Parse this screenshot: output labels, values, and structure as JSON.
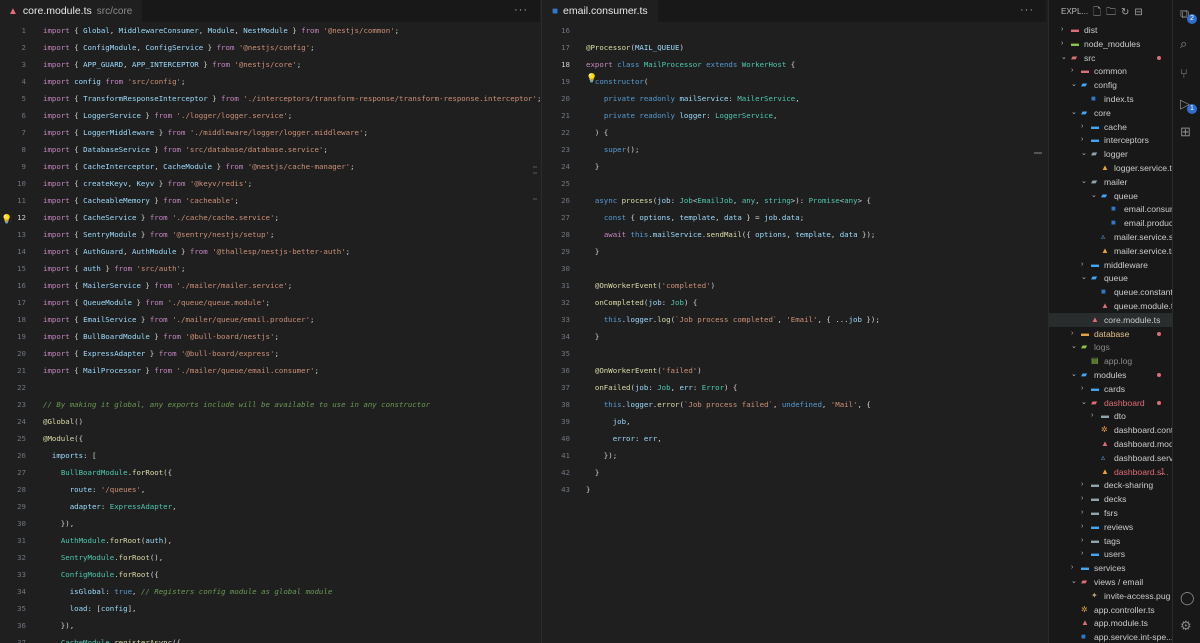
{
  "pane1": {
    "tab": {
      "name": "core.module.ts",
      "path": "src/core"
    },
    "lines": [
      {
        "n": "1",
        "h": "<span class=\"k\">import</span> { <span class=\"v\">Global</span>, <span class=\"v\">MiddlewareConsumer</span>, <span class=\"v\">Module</span>, <span class=\"v\">NestModule</span> } <span class=\"k\">from</span> <span class=\"s\">'@nestjs/common'</span>;"
      },
      {
        "n": "2",
        "h": "<span class=\"k\">import</span> { <span class=\"v\">ConfigModule</span>, <span class=\"v\">ConfigService</span> } <span class=\"k\">from</span> <span class=\"s\">'@nestjs/config'</span>;"
      },
      {
        "n": "3",
        "h": "<span class=\"k\">import</span> { <span class=\"v\">APP_GUARD</span>, <span class=\"v\">APP_INTERCEPTOR</span> } <span class=\"k\">from</span> <span class=\"s\">'@nestjs/core'</span>;"
      },
      {
        "n": "4",
        "h": "<span class=\"k\">import</span> <span class=\"v\">config</span> <span class=\"k\">from</span> <span class=\"s\">'src/config'</span>;"
      },
      {
        "n": "5",
        "h": "<span class=\"k\">import</span> { <span class=\"v\">TransformResponseInterceptor</span> } <span class=\"k\">from</span> <span class=\"s\">'./interceptors/transform-response/transform-response.interceptor'</span>;"
      },
      {
        "n": "6",
        "h": "<span class=\"k\">import</span> { <span class=\"v\">LoggerService</span> } <span class=\"k\">from</span> <span class=\"s\">'./logger/logger.service'</span>;"
      },
      {
        "n": "7",
        "h": "<span class=\"k\">import</span> { <span class=\"v\">LoggerMiddleware</span> } <span class=\"k\">from</span> <span class=\"s\">'./middleware/logger/logger.middleware'</span>;"
      },
      {
        "n": "8",
        "h": "<span class=\"k\">import</span> { <span class=\"v\">DatabaseService</span> } <span class=\"k\">from</span> <span class=\"s\">'src/database/database.service'</span>;"
      },
      {
        "n": "9",
        "h": "<span class=\"k\">import</span> { <span class=\"v\">CacheInterceptor</span>, <span class=\"v\">CacheModule</span> } <span class=\"k\">from</span> <span class=\"s\">'@nestjs/cache-manager'</span>;"
      },
      {
        "n": "10",
        "h": "<span class=\"k\">import</span> { <span class=\"v\">createKeyv</span>, <span class=\"v\">Keyv</span> } <span class=\"k\">from</span> <span class=\"s\">'@keyv/redis'</span>;"
      },
      {
        "n": "11",
        "h": "<span class=\"k\">import</span> { <span class=\"v\">CacheableMemory</span> } <span class=\"k\">from</span> <span class=\"s\">'cacheable'</span>;"
      },
      {
        "n": "12",
        "h": "<span class=\"k\">import</span> { <span class=\"v\">CacheService</span> } <span class=\"k\">from</span> <span class=\"s\">'./cache/cache.service'</span>;"
      },
      {
        "n": "13",
        "h": "<span class=\"k\">import</span> { <span class=\"v\">SentryModule</span> } <span class=\"k\">from</span> <span class=\"s\">'@sentry/nestjs/setup'</span>;"
      },
      {
        "n": "14",
        "h": "<span class=\"k\">import</span> { <span class=\"v\">AuthGuard</span>, <span class=\"v\">AuthModule</span> } <span class=\"k\">from</span> <span class=\"s\">'@thallesp/nestjs-better-auth'</span>;"
      },
      {
        "n": "15",
        "h": "<span class=\"k\">import</span> { <span class=\"v\">auth</span> } <span class=\"k\">from</span> <span class=\"s\">'src/auth'</span>;"
      },
      {
        "n": "16",
        "h": "<span class=\"k\">import</span> { <span class=\"v\">MailerService</span> } <span class=\"k\">from</span> <span class=\"s\">'./mailer/mailer.service'</span>;"
      },
      {
        "n": "17",
        "h": "<span class=\"k\">import</span> { <span class=\"v\">QueueModule</span> } <span class=\"k\">from</span> <span class=\"s\">'./queue/queue.module'</span>;"
      },
      {
        "n": "18",
        "h": "<span class=\"k\">import</span> { <span class=\"v\">EmailService</span> } <span class=\"k\">from</span> <span class=\"s\">'./mailer/queue/email.producer'</span>;"
      },
      {
        "n": "19",
        "h": "<span class=\"k\">import</span> { <span class=\"v\">BullBoardModule</span> } <span class=\"k\">from</span> <span class=\"s\">'@bull-board/nestjs'</span>;"
      },
      {
        "n": "20",
        "h": "<span class=\"k\">import</span> { <span class=\"v\">ExpressAdapter</span> } <span class=\"k\">from</span> <span class=\"s\">'@bull-board/express'</span>;"
      },
      {
        "n": "21",
        "h": "<span class=\"k\">import</span> { <span class=\"v\">MailProcessor</span> } <span class=\"k\">from</span> <span class=\"s\">'./mailer/queue/email.consumer'</span>;"
      },
      {
        "n": "22",
        "h": ""
      },
      {
        "n": "23",
        "h": "<span class=\"c\">// By making it global, any exports include will be available to use in any constructor</span>"
      },
      {
        "n": "24",
        "h": "<span class=\"d\">@Global</span>()"
      },
      {
        "n": "25",
        "h": "<span class=\"d\">@Module</span>({"
      },
      {
        "n": "26",
        "h": "  <span class=\"v\">imports</span>: ["
      },
      {
        "n": "27",
        "h": "    <span class=\"t\">BullBoardModule</span>.<span class=\"f\">forRoot</span>({"
      },
      {
        "n": "28",
        "h": "      <span class=\"v\">route</span>: <span class=\"s\">'/queues'</span>,"
      },
      {
        "n": "29",
        "h": "      <span class=\"v\">adapter</span>: <span class=\"t\">ExpressAdapter</span>,"
      },
      {
        "n": "30",
        "h": "    }),"
      },
      {
        "n": "31",
        "h": "    <span class=\"t\">AuthModule</span>.<span class=\"f\">forRoot</span>(<span class=\"v\">auth</span>),"
      },
      {
        "n": "32",
        "h": "    <span class=\"t\">SentryModule</span>.<span class=\"f\">forRoot</span>(),"
      },
      {
        "n": "33",
        "h": "    <span class=\"t\">ConfigModule</span>.<span class=\"f\">forRoot</span>({"
      },
      {
        "n": "34",
        "h": "      <span class=\"v\">isGlobal</span>: <span class=\"kb\">true</span>, <span class=\"c\">// Registers config module as global module</span>"
      },
      {
        "n": "35",
        "h": "      <span class=\"v\">load</span>: [<span class=\"v\">config</span>],"
      },
      {
        "n": "36",
        "h": "    }),"
      },
      {
        "n": "37",
        "h": "    <span class=\"t\">CacheModule</span>.<span class=\"f\">registerAsync</span>({"
      }
    ]
  },
  "pane2": {
    "tab": {
      "name": "email.consumer.ts"
    },
    "lines": [
      {
        "n": "16",
        "h": ""
      },
      {
        "n": "17",
        "h": "<span class=\"d\">@Processor</span>(<span class=\"v\">MAIL_QUEUE</span>)"
      },
      {
        "n": "18",
        "h": "<span class=\"k\">export</span> <span class=\"kb\">class</span> <span class=\"t\">MailProcessor</span> <span class=\"kb\">extends</span> <span class=\"t\">WorkerHost</span> {"
      },
      {
        "n": "19",
        "h": "  <span class=\"kb\">constructor</span>("
      },
      {
        "n": "20",
        "h": "    <span class=\"kb\">private readonly</span> <span class=\"v\">mailService</span>: <span class=\"t\">MailerService</span>,"
      },
      {
        "n": "21",
        "h": "    <span class=\"kb\">private readonly</span> <span class=\"v\">logger</span>: <span class=\"t\">LoggerService</span>,"
      },
      {
        "n": "22",
        "h": "  ) {"
      },
      {
        "n": "23",
        "h": "    <span class=\"kb\">super</span>();"
      },
      {
        "n": "24",
        "h": "  }"
      },
      {
        "n": "25",
        "h": ""
      },
      {
        "n": "26",
        "h": "  <span class=\"kb\">async</span> <span class=\"f\">process</span>(<span class=\"v\">job</span>: <span class=\"t\">Job</span>&lt;<span class=\"t\">EmailJob</span>, <span class=\"t\">any</span>, <span class=\"t\">string</span>&gt;): <span class=\"t\">Promise</span>&lt;<span class=\"t\">any</span>&gt; {"
      },
      {
        "n": "27",
        "h": "    <span class=\"kb\">const</span> { <span class=\"v\">options</span>, <span class=\"v\">template</span>, <span class=\"v\">data</span> } = <span class=\"v\">job</span>.<span class=\"v\">data</span>;"
      },
      {
        "n": "28",
        "h": "    <span class=\"k\">await</span> <span class=\"kb\">this</span>.<span class=\"v\">mailService</span>.<span class=\"f\">sendMail</span>({ <span class=\"v\">options</span>, <span class=\"v\">template</span>, <span class=\"v\">data</span> });"
      },
      {
        "n": "29",
        "h": "  }"
      },
      {
        "n": "30",
        "h": ""
      },
      {
        "n": "31",
        "h": "  <span class=\"d\">@OnWorkerEvent</span>(<span class=\"s\">'completed'</span>)"
      },
      {
        "n": "32",
        "h": "  <span class=\"f\">onCompleted</span>(<span class=\"v\">job</span>: <span class=\"t\">Job</span>) {"
      },
      {
        "n": "33",
        "h": "    <span class=\"kb\">this</span>.<span class=\"v\">logger</span>.<span class=\"f\">log</span>(<span class=\"s\">`Job process completed`</span>, <span class=\"s\">'Email'</span>, { ...<span class=\"v\">job</span> });"
      },
      {
        "n": "34",
        "h": "  }"
      },
      {
        "n": "35",
        "h": ""
      },
      {
        "n": "36",
        "h": "  <span class=\"d\">@OnWorkerEvent</span>(<span class=\"s\">'failed'</span>)"
      },
      {
        "n": "37",
        "h": "  <span class=\"f\">onFailed</span>(<span class=\"v\">job</span>: <span class=\"t\">Job</span>, <span class=\"v\">err</span>: <span class=\"t\">Error</span>) {"
      },
      {
        "n": "38",
        "h": "    <span class=\"kb\">this</span>.<span class=\"v\">logger</span>.<span class=\"f\">error</span>(<span class=\"s\">`Job process failed`</span>, <span class=\"kb\">undefined</span>, <span class=\"s\">'Mail'</span>, {"
      },
      {
        "n": "39",
        "h": "      <span class=\"v\">job</span>,"
      },
      {
        "n": "40",
        "h": "      <span class=\"v\">error</span>: <span class=\"v\">err</span>,"
      },
      {
        "n": "41",
        "h": "    });"
      },
      {
        "n": "42",
        "h": "  }"
      },
      {
        "n": "43",
        "h": "}"
      }
    ]
  },
  "explorer": {
    "header": "EXPL...",
    "tree": [
      {
        "lvl": 0,
        "kind": "folder",
        "open": false,
        "label": "dist",
        "color": "#e06c75"
      },
      {
        "lvl": 0,
        "kind": "folder",
        "open": false,
        "label": "node_modules",
        "color": "#8bc34a"
      },
      {
        "lvl": 0,
        "kind": "folder",
        "open": true,
        "label": "src",
        "color": "#e06c75",
        "dot": true
      },
      {
        "lvl": 1,
        "kind": "folder",
        "open": false,
        "label": "common",
        "color": "#e06c75"
      },
      {
        "lvl": 1,
        "kind": "folder",
        "open": true,
        "label": "config",
        "color": "#42a5f5"
      },
      {
        "lvl": 2,
        "kind": "file",
        "label": "index.ts",
        "color": "#3178c6",
        "icon": "■"
      },
      {
        "lvl": 1,
        "kind": "folder",
        "open": true,
        "label": "core",
        "color": "#42a5f5"
      },
      {
        "lvl": 2,
        "kind": "folder",
        "open": false,
        "label": "cache",
        "color": "#42a5f5"
      },
      {
        "lvl": 2,
        "kind": "folder",
        "open": false,
        "label": "interceptors",
        "color": "#42a5f5"
      },
      {
        "lvl": 2,
        "kind": "folder",
        "open": true,
        "label": "logger",
        "color": "#90a4ae"
      },
      {
        "lvl": 3,
        "kind": "file",
        "label": "logger.service.ts",
        "color": "#e6a23c",
        "icon": "▲"
      },
      {
        "lvl": 2,
        "kind": "folder",
        "open": true,
        "label": "mailer",
        "color": "#90a4ae"
      },
      {
        "lvl": 3,
        "kind": "folder",
        "open": true,
        "label": "queue",
        "color": "#42a5f5"
      },
      {
        "lvl": 4,
        "kind": "file",
        "label": "email.consumer...",
        "color": "#3178c6",
        "icon": "■"
      },
      {
        "lvl": 4,
        "kind": "file",
        "label": "email.producer.ts",
        "color": "#3178c6",
        "icon": "■"
      },
      {
        "lvl": 3,
        "kind": "file",
        "label": "mailer.service.sp...",
        "color": "#5c9cf5",
        "icon": "▵"
      },
      {
        "lvl": 3,
        "kind": "file",
        "label": "mailer.service.ts",
        "color": "#e6a23c",
        "icon": "▲"
      },
      {
        "lvl": 2,
        "kind": "folder",
        "open": false,
        "label": "middleware",
        "color": "#42a5f5"
      },
      {
        "lvl": 2,
        "kind": "folder",
        "open": true,
        "label": "queue",
        "color": "#42a5f5"
      },
      {
        "lvl": 3,
        "kind": "file",
        "label": "queue.constants.ts",
        "color": "#3178c6",
        "icon": "■"
      },
      {
        "lvl": 3,
        "kind": "file",
        "label": "queue.module.ts",
        "color": "#e06c75",
        "icon": "▲"
      },
      {
        "lvl": 2,
        "kind": "file",
        "label": "core.module.ts",
        "color": "#e06c75",
        "icon": "▲",
        "sel": true
      },
      {
        "lvl": 1,
        "kind": "folder",
        "open": false,
        "label": "database",
        "color": "#e6a23c",
        "lblcolor": "#e2c08d",
        "dot": true
      },
      {
        "lvl": 1,
        "kind": "folder",
        "open": true,
        "label": "logs",
        "color": "#8bc34a",
        "lblcolor": "#8b8b8b"
      },
      {
        "lvl": 2,
        "kind": "file",
        "label": "app.log",
        "color": "#8bc34a",
        "icon": "▤",
        "lblcolor": "#8b8b8b"
      },
      {
        "lvl": 1,
        "kind": "folder",
        "open": true,
        "label": "modules",
        "color": "#42a5f5",
        "dot": true
      },
      {
        "lvl": 2,
        "kind": "folder",
        "open": false,
        "label": "cards",
        "color": "#42a5f5"
      },
      {
        "lvl": 2,
        "kind": "folder",
        "open": true,
        "label": "dashboard",
        "color": "#e06c75",
        "lblcolor": "#e06c75",
        "dot": true
      },
      {
        "lvl": 3,
        "kind": "folder",
        "open": false,
        "label": "dto",
        "color": "#90a4ae"
      },
      {
        "lvl": 3,
        "kind": "file",
        "label": "dashboard.contr...",
        "color": "#e6a23c",
        "icon": "✲"
      },
      {
        "lvl": 3,
        "kind": "file",
        "label": "dashboard.modu...",
        "color": "#e06c75",
        "icon": "▲"
      },
      {
        "lvl": 3,
        "kind": "file",
        "label": "dashboard.servic...",
        "color": "#5c9cf5",
        "icon": "▵"
      },
      {
        "lvl": 3,
        "kind": "file",
        "label": "dashboard.s...",
        "color": "#e6a23c",
        "icon": "▲",
        "lblcolor": "#e06c75",
        "badge": "1"
      },
      {
        "lvl": 2,
        "kind": "folder",
        "open": false,
        "label": "deck-sharing",
        "color": "#90a4ae"
      },
      {
        "lvl": 2,
        "kind": "folder",
        "open": false,
        "label": "decks",
        "color": "#90a4ae"
      },
      {
        "lvl": 2,
        "kind": "folder",
        "open": false,
        "label": "fsrs",
        "color": "#90a4ae"
      },
      {
        "lvl": 2,
        "kind": "folder",
        "open": false,
        "label": "reviews",
        "color": "#42a5f5"
      },
      {
        "lvl": 2,
        "kind": "folder",
        "open": false,
        "label": "tags",
        "color": "#90a4ae"
      },
      {
        "lvl": 2,
        "kind": "folder",
        "open": false,
        "label": "users",
        "color": "#42a5f5"
      },
      {
        "lvl": 1,
        "kind": "folder",
        "open": false,
        "label": "services",
        "color": "#42a5f5"
      },
      {
        "lvl": 1,
        "kind": "folder",
        "open": true,
        "label": "views / email",
        "color": "#e06c75"
      },
      {
        "lvl": 2,
        "kind": "file",
        "label": "invite-access.pug",
        "color": "#c2a27a",
        "icon": "✦"
      },
      {
        "lvl": 1,
        "kind": "file",
        "label": "app.controller.ts",
        "color": "#e6a23c",
        "icon": "✲"
      },
      {
        "lvl": 1,
        "kind": "file",
        "label": "app.module.ts",
        "color": "#e06c75",
        "icon": "▲"
      },
      {
        "lvl": 1,
        "kind": "file",
        "label": "app.service.int-spe...",
        "color": "#3178c6",
        "icon": "■"
      }
    ]
  },
  "activity": {
    "source_badge": "2",
    "ext_badge": "1"
  }
}
